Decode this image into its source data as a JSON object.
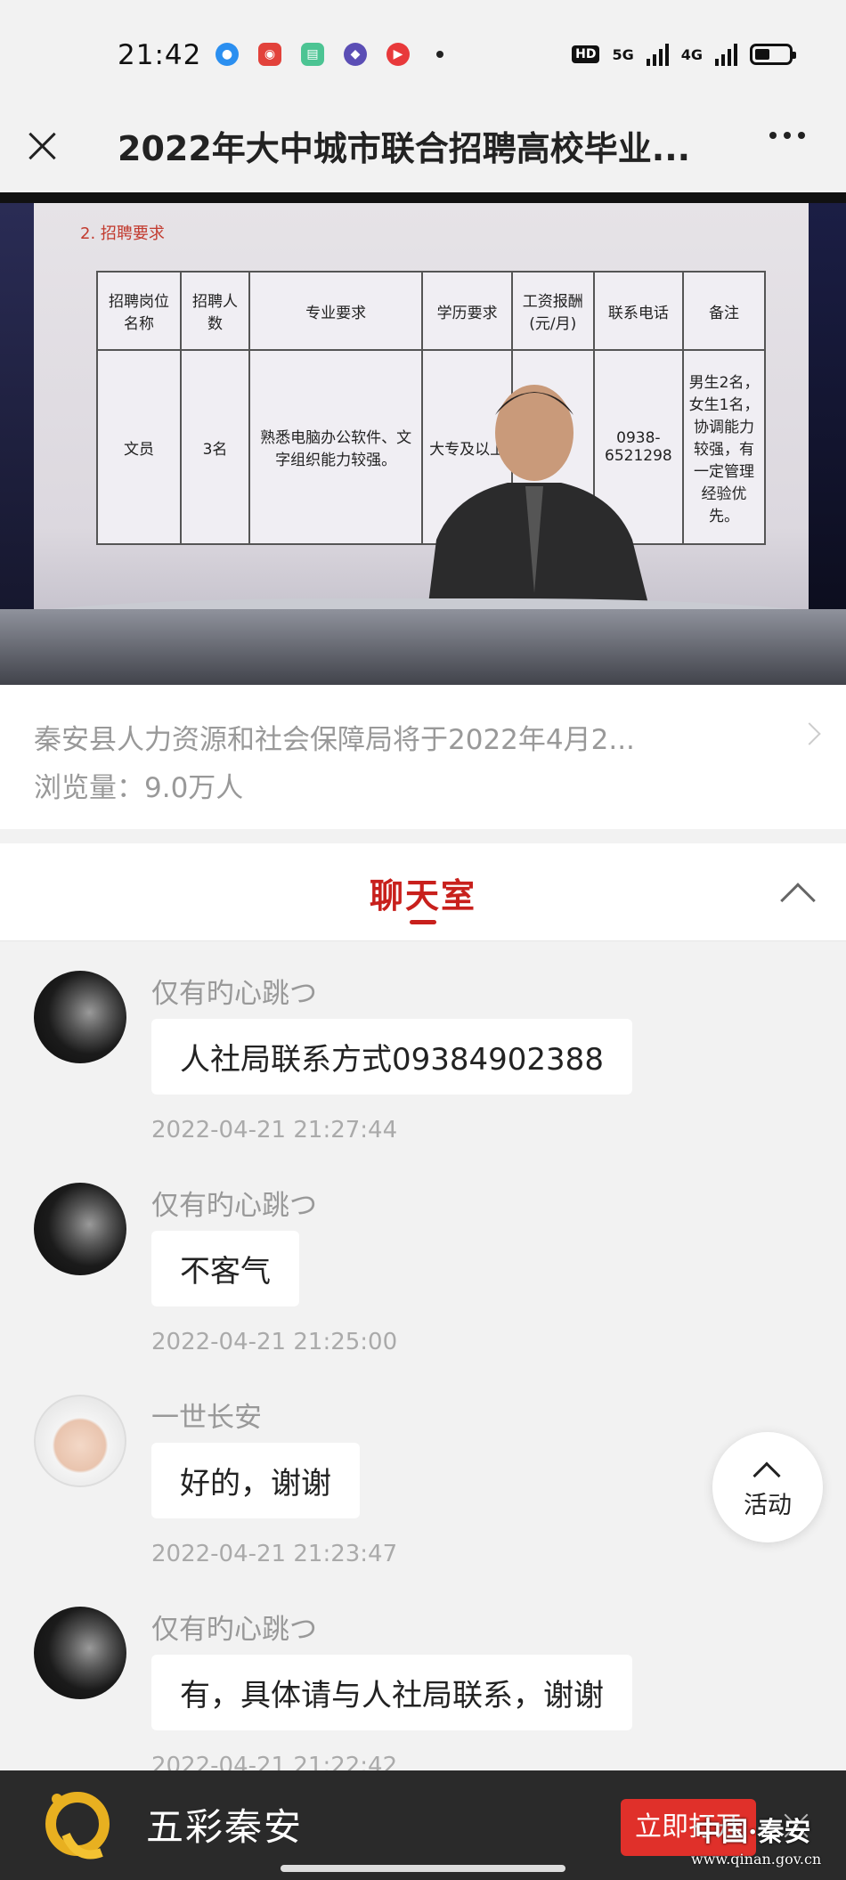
{
  "status_bar": {
    "time": "21:42",
    "apps": [
      {
        "icon": "app-circle-icon",
        "color": "#2b8ff0"
      },
      {
        "icon": "app-netease-music-icon",
        "color": "#e2423b"
      },
      {
        "icon": "app-green-icon",
        "color": "#4cc493"
      },
      {
        "icon": "app-purple-icon",
        "color": "#5b4eb5"
      },
      {
        "icon": "app-play-icon",
        "color": "#e8393b"
      }
    ],
    "hd_label": "HD",
    "net_5g": "5G",
    "net_4g": "4G"
  },
  "title_bar": {
    "title": "2022年大中城市联合招聘高校毕业..."
  },
  "video": {
    "slide_heading": "2. 招聘要求",
    "table": {
      "headers": [
        "招聘岗位名称",
        "招聘人数",
        "专业要求",
        "学历要求",
        "工资报酬(元/月)",
        "联系电话",
        "备注"
      ],
      "row": [
        "文员",
        "3名",
        "熟悉电脑办公软件、文字组织能力较强。",
        "大专及以上",
        "",
        "0938-6521298",
        "男生2名，女生1名，协调能力较强，有一定管理经验优先。"
      ]
    }
  },
  "description": {
    "text": "秦安县人力资源和社会保障局将于2022年4月2...",
    "views": "浏览量：9.0万人"
  },
  "chat_tab": {
    "label": "聊天室"
  },
  "messages": [
    {
      "name": "仅有旳心跳つ",
      "text": "人社局联系方式09384902388",
      "time": "2022-04-21 21:27:44",
      "avatar": "dark"
    },
    {
      "name": "仅有旳心跳つ",
      "text": "不客气",
      "time": "2022-04-21 21:25:00",
      "avatar": "dark"
    },
    {
      "name": "一世长安",
      "text": "好的，谢谢",
      "time": "2022-04-21 21:23:47",
      "avatar": "baby"
    },
    {
      "name": "仅有旳心跳つ",
      "text": "有，具体请与人社局联系，谢谢",
      "time": "2022-04-21 21:22:42",
      "avatar": "dark"
    }
  ],
  "activity": {
    "label": "活动"
  },
  "banner": {
    "app_name": "五彩秦安",
    "open_label": "立即打开"
  },
  "watermark": {
    "cn": "中国·秦安",
    "url": "www.qinan.gov.cn"
  },
  "colors": {
    "accent": "#c8201c",
    "open_button": "#e0302a"
  }
}
